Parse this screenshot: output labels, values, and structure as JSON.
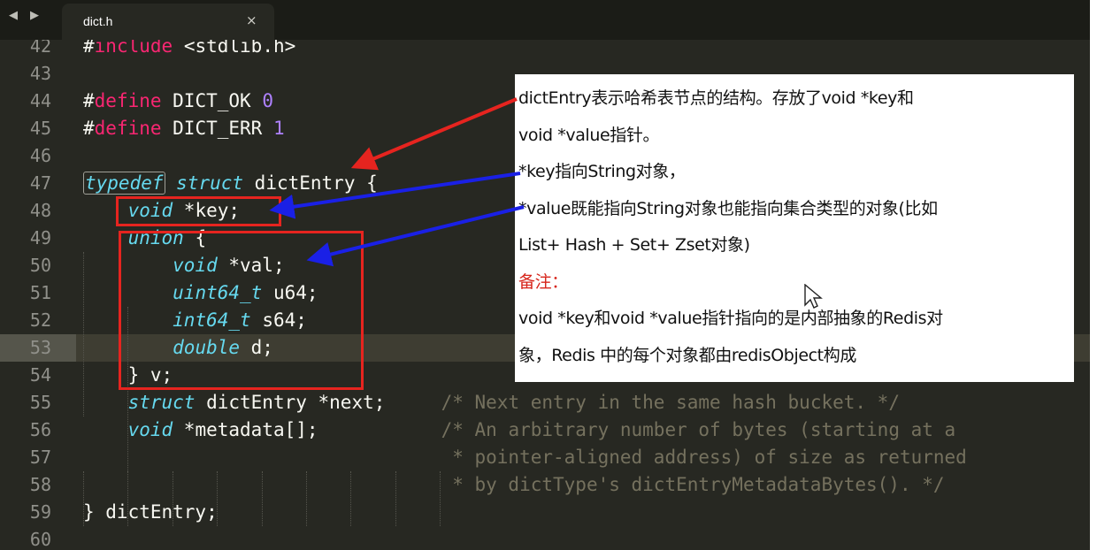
{
  "tabbar": {
    "back_icon": "back-arrow-icon",
    "forward_icon": "forward-arrow-icon",
    "tab": {
      "title": "dict.h",
      "close_glyph": "×"
    }
  },
  "editor": {
    "current_line": "53",
    "lines": [
      {
        "n": "42",
        "code": "#include <stdlib.h>"
      },
      {
        "n": "43",
        "code": ""
      },
      {
        "n": "44",
        "code": "#define DICT_OK 0"
      },
      {
        "n": "45",
        "code": "#define DICT_ERR 1"
      },
      {
        "n": "46",
        "code": ""
      },
      {
        "n": "47",
        "code": "typedef struct dictEntry {"
      },
      {
        "n": "48",
        "code": "    void *key;"
      },
      {
        "n": "49",
        "code": "    union {"
      },
      {
        "n": "50",
        "code": "        void *val;"
      },
      {
        "n": "51",
        "code": "        uint64_t u64;"
      },
      {
        "n": "52",
        "code": "        int64_t s64;"
      },
      {
        "n": "53",
        "code": "        double d;"
      },
      {
        "n": "54",
        "code": "    } v;"
      },
      {
        "n": "55",
        "code": "    struct dictEntry *next;     /* Next entry in the same hash bucket. */"
      },
      {
        "n": "56",
        "code": "    void *metadata[];           /* An arbitrary number of bytes (starting at a"
      },
      {
        "n": "57",
        "code": "                                 * pointer-aligned address) of size as returned"
      },
      {
        "n": "58",
        "code": "                                 * by dictType's dictEntryMetadataBytes(). */"
      },
      {
        "n": "59",
        "code": "} dictEntry;"
      },
      {
        "n": "60",
        "code": ""
      }
    ]
  },
  "annotation": {
    "lines": [
      "dictEntry表示哈希表节点的结构。存放了void *key和",
      "void *value指针。",
      "*key指向String对象，",
      "*value既能指向String对象也能指向集合类型的对象(比如",
      "List+ Hash  + Set+ Zset对象)",
      "备注：",
      "void *key和void *value指针指向的是内部抽象的Redis对",
      "象，Redis 中的每个对象都由redisObject构成"
    ],
    "heading_index": 5
  },
  "colors": {
    "background": "#272822",
    "keyword": "#f92672",
    "type": "#66d9ef",
    "number": "#ae81ff",
    "comment": "#75715e",
    "highlight_box": "#e6241f",
    "arrow_red": "#e6241f",
    "arrow_blue": "#1a20e6",
    "note_heading": "#d7261c"
  }
}
